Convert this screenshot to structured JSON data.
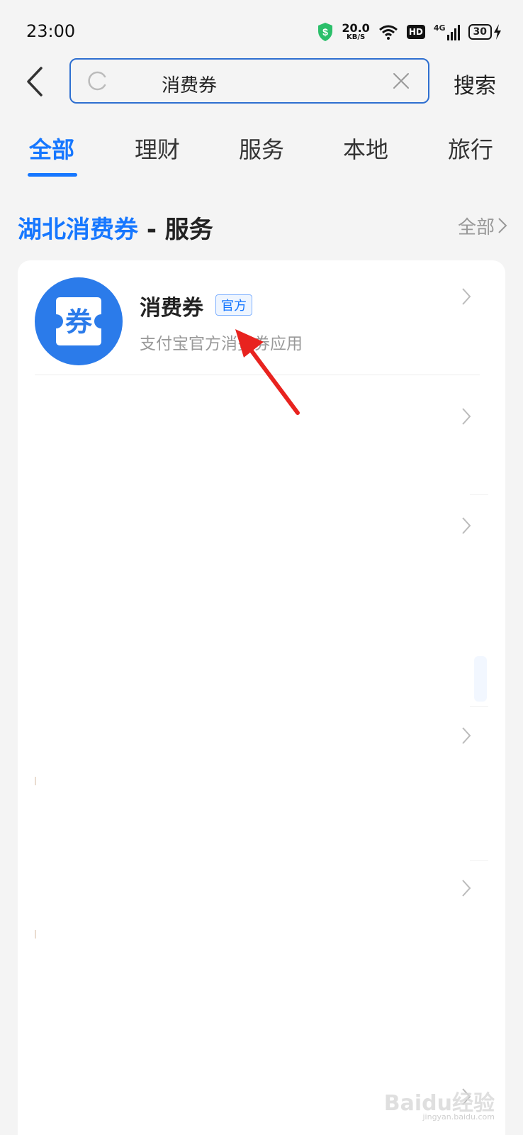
{
  "status_bar": {
    "time": "23:00",
    "net_speed": "20.0",
    "net_speed_unit": "KB/S",
    "hd_label": "HD",
    "network_label": "4G",
    "battery_level": "30",
    "icons": [
      "shield-icon",
      "wifi-icon",
      "signal-icon",
      "battery-icon",
      "charging-icon"
    ]
  },
  "search": {
    "query": "消费券",
    "button_label": "搜索"
  },
  "tabs": [
    {
      "label": "全部",
      "active": true
    },
    {
      "label": "理财",
      "active": false
    },
    {
      "label": "服务",
      "active": false
    },
    {
      "label": "本地",
      "active": false
    },
    {
      "label": "旅行",
      "active": false
    }
  ],
  "section": {
    "keyword": "湖北消费券",
    "separator": " - ",
    "category": "服务",
    "view_all_label": "全部"
  },
  "results": [
    {
      "name": "消费券",
      "badge": "官方",
      "description": "支付宝官方消费券应用",
      "icon_glyph": "券"
    }
  ],
  "colors": {
    "accent": "#1677ff",
    "search_border": "#2e6fd0",
    "arrow": "#e8231f",
    "icon_bg": "#2b7bea"
  },
  "watermark": {
    "text": "Baidu经验",
    "url_text": "jingyan.baidu.com"
  }
}
